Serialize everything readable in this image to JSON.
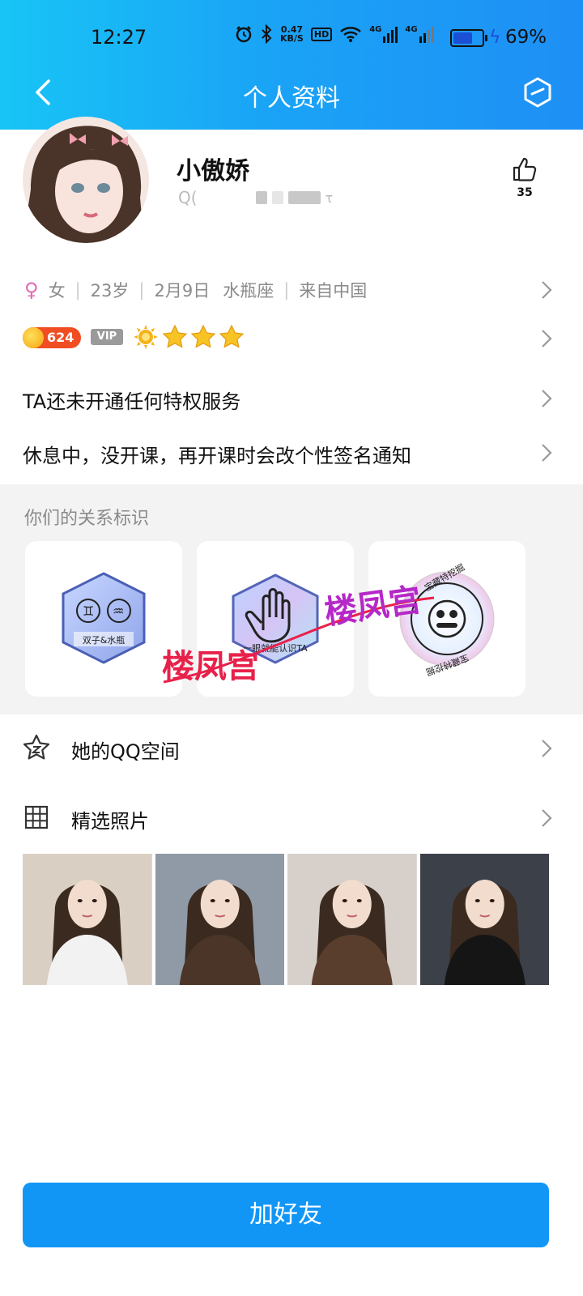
{
  "status_bar": {
    "time": "12:27",
    "net_speed_top": "0.47",
    "net_speed_bottom": "KB/S",
    "hd": "HD",
    "net1": "4G",
    "net2": "4G",
    "battery_percent": "69%",
    "battery_level": 0.69
  },
  "header": {
    "title": "个人资料"
  },
  "profile": {
    "nickname": "小傲娇",
    "qq_prefix": "Q(",
    "qq_tail": "τ",
    "likes": "35"
  },
  "info": {
    "gender": "女",
    "age": "23岁",
    "birthday": "2月9日",
    "zodiac": "水瓶座",
    "location": "来自中国"
  },
  "badges": {
    "coins": "624",
    "vip": "VIP",
    "stars": 3
  },
  "privilege_text": "TA还未开通任何特权服务",
  "signature": "休息中，没开课，再开课时会改个性签名通知",
  "relations": {
    "title": "你们的关系标识",
    "cards": [
      {
        "label": "双子&水瓶",
        "icon": "gemini-aquarius-icon"
      },
      {
        "label": "一眼就能认识TA",
        "icon": "raised-hand-icon"
      },
      {
        "label_top": "宝藏特挖掘",
        "label_bottom": "宝藏特挖掘",
        "icon": "smiley-face-icon"
      }
    ]
  },
  "menu": {
    "qzone": "她的QQ空间",
    "photos": "精选照片"
  },
  "photos": [
    {
      "name": "photo-1",
      "bg": "#d9cfc3",
      "shirt": "#f2f2f2"
    },
    {
      "name": "photo-2",
      "bg": "#8f9aa6",
      "shirt": "#4a3528"
    },
    {
      "name": "photo-3",
      "bg": "#d6cfca",
      "shirt": "#5a3e2d"
    },
    {
      "name": "photo-4",
      "bg": "#3c4048",
      "shirt": "#151515"
    }
  ],
  "add_friend": "加好友",
  "watermark": "楼凤宫",
  "colors": {
    "header_start": "#18c4f6",
    "header_end": "#1e8ff5",
    "button": "#1296f5",
    "coin": "#f04d22",
    "female": "#e06bb3"
  }
}
